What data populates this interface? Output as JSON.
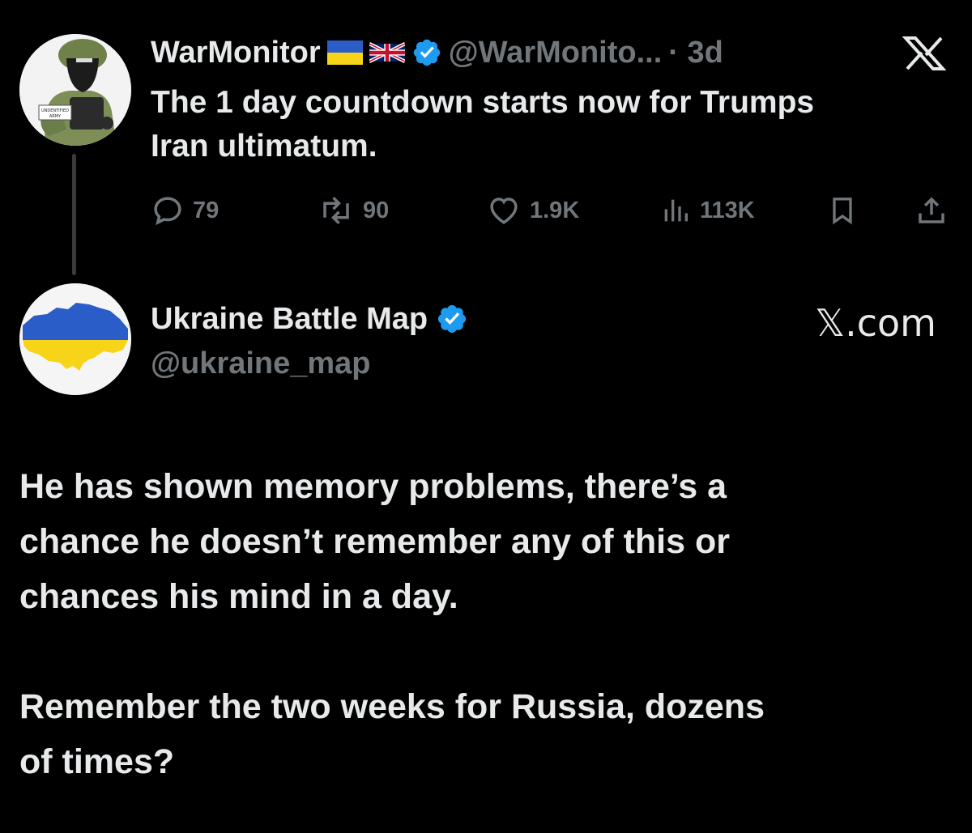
{
  "tweet": {
    "author_name": "WarMonitor",
    "handle": "@WarMonito...",
    "time": "· 3d",
    "text_line1": "The 1 day countdown starts now for Trumps",
    "text_line2": "Iran ultimatum.",
    "metrics": {
      "replies": "79",
      "reposts": "90",
      "likes": "1.9K",
      "views": "113K"
    },
    "avatar_patch_text": "UNDENTIFIED ARMY"
  },
  "reply": {
    "author_name": "Ukraine Battle Map",
    "handle": "@ukraine_map",
    "brand": "𝕏.com",
    "paragraph1": [
      "He has shown memory problems, there’s a",
      "chance he doesn’t remember any of this or",
      "chances his mind in a day."
    ],
    "paragraph2": [
      "Remember the two weeks for Russia, dozens",
      "of times?"
    ]
  },
  "colors": {
    "background": "#000000",
    "text": "#e7e9ea",
    "muted": "#71767b",
    "verified": "#1d9bf0",
    "ukraine_blue": "#2a5dc8",
    "ukraine_yellow": "#f7d417"
  }
}
